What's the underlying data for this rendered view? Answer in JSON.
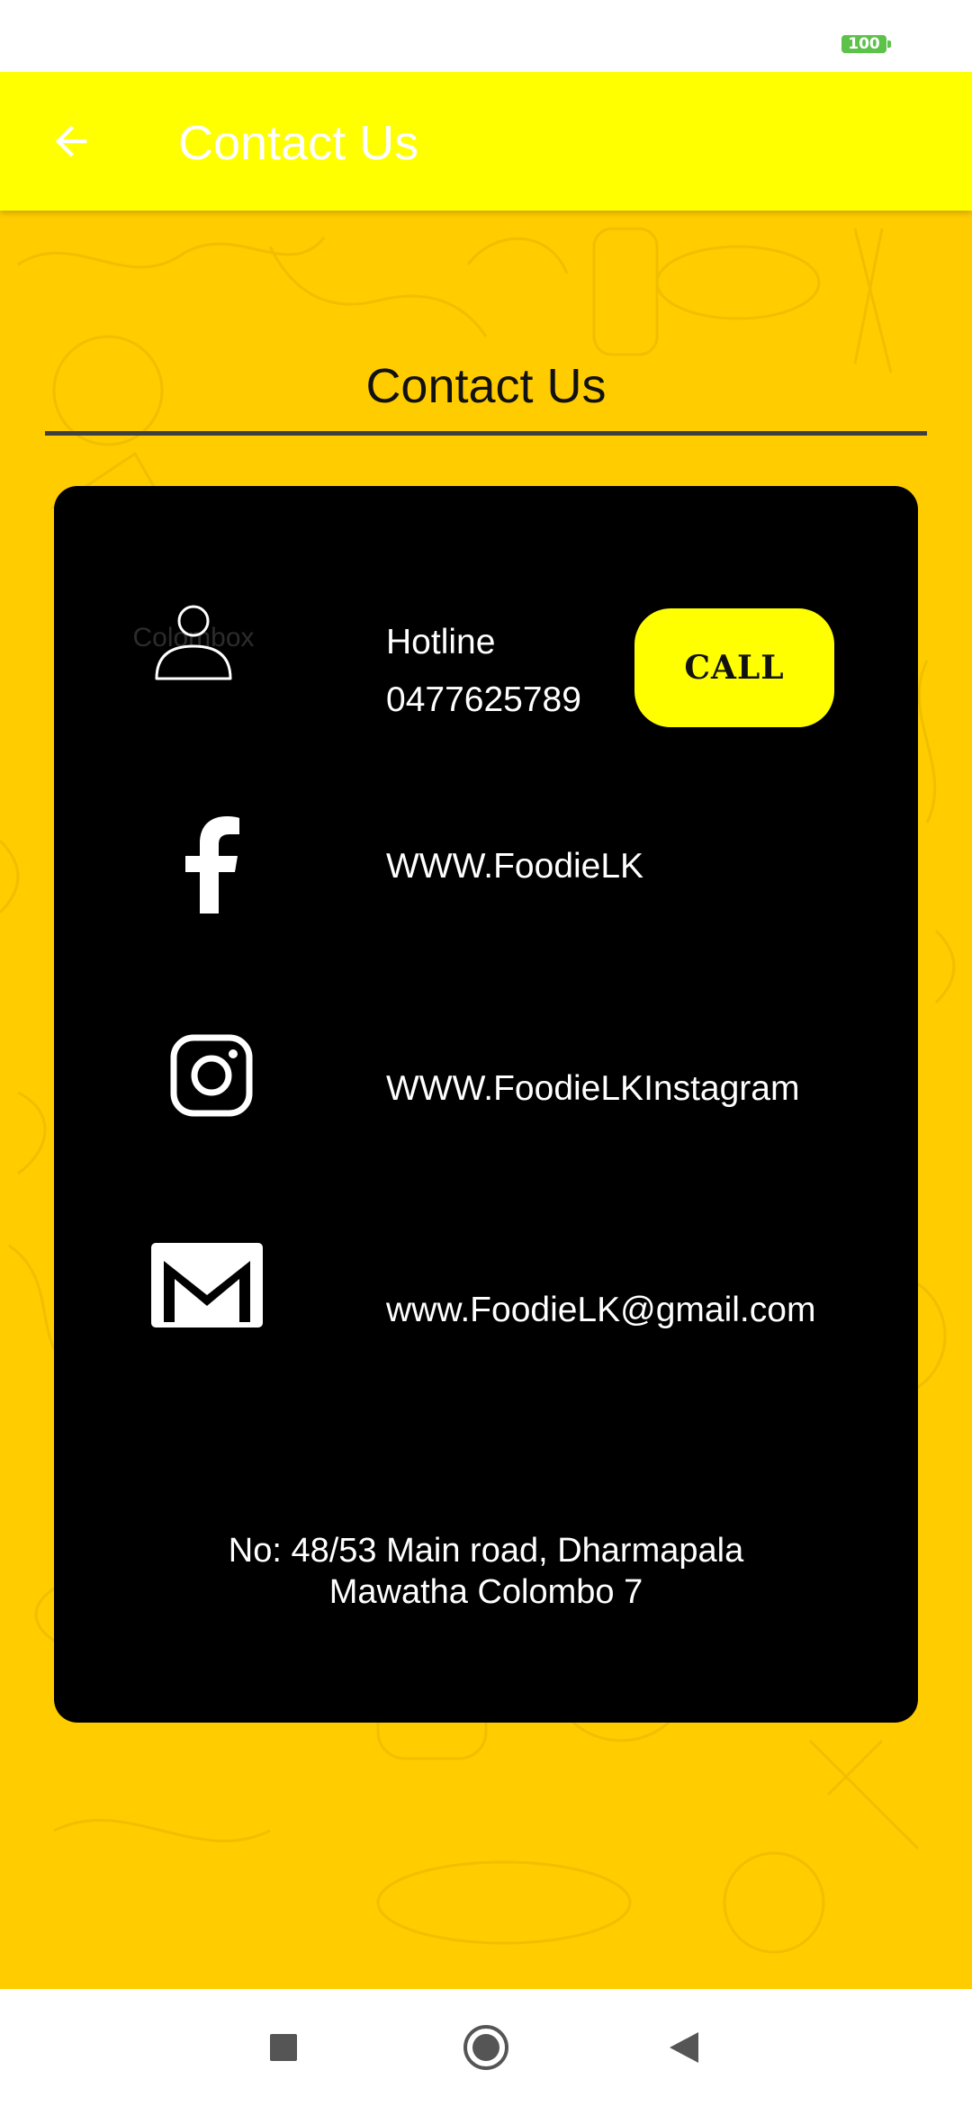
{
  "status_bar": {
    "battery_level": "100"
  },
  "app_bar": {
    "title": "Contact Us",
    "background_color": "#ffff00"
  },
  "main": {
    "section_title": "Contact Us",
    "background_color": "#ffcc00",
    "card": {
      "background_color": "#000000",
      "hotline": {
        "label": "Hotline",
        "number": "0477625789",
        "call_label": "CALL",
        "icon": "user-icon",
        "watermark": "Colombox"
      },
      "facebook": {
        "text": "WWW.FoodieLK",
        "icon": "facebook-icon"
      },
      "instagram": {
        "text": "WWW.FoodieLKInstagram",
        "icon": "instagram-icon"
      },
      "email": {
        "text": "www.FoodieLK@gmail.com",
        "icon": "mail-icon"
      },
      "address": {
        "line1": "No: 48/53 Main road, Dharmapala",
        "line2": "Mawatha Colombo 7"
      }
    }
  },
  "nav_bar": {
    "recents": "recents-icon",
    "home": "home-icon",
    "back": "back-icon"
  }
}
